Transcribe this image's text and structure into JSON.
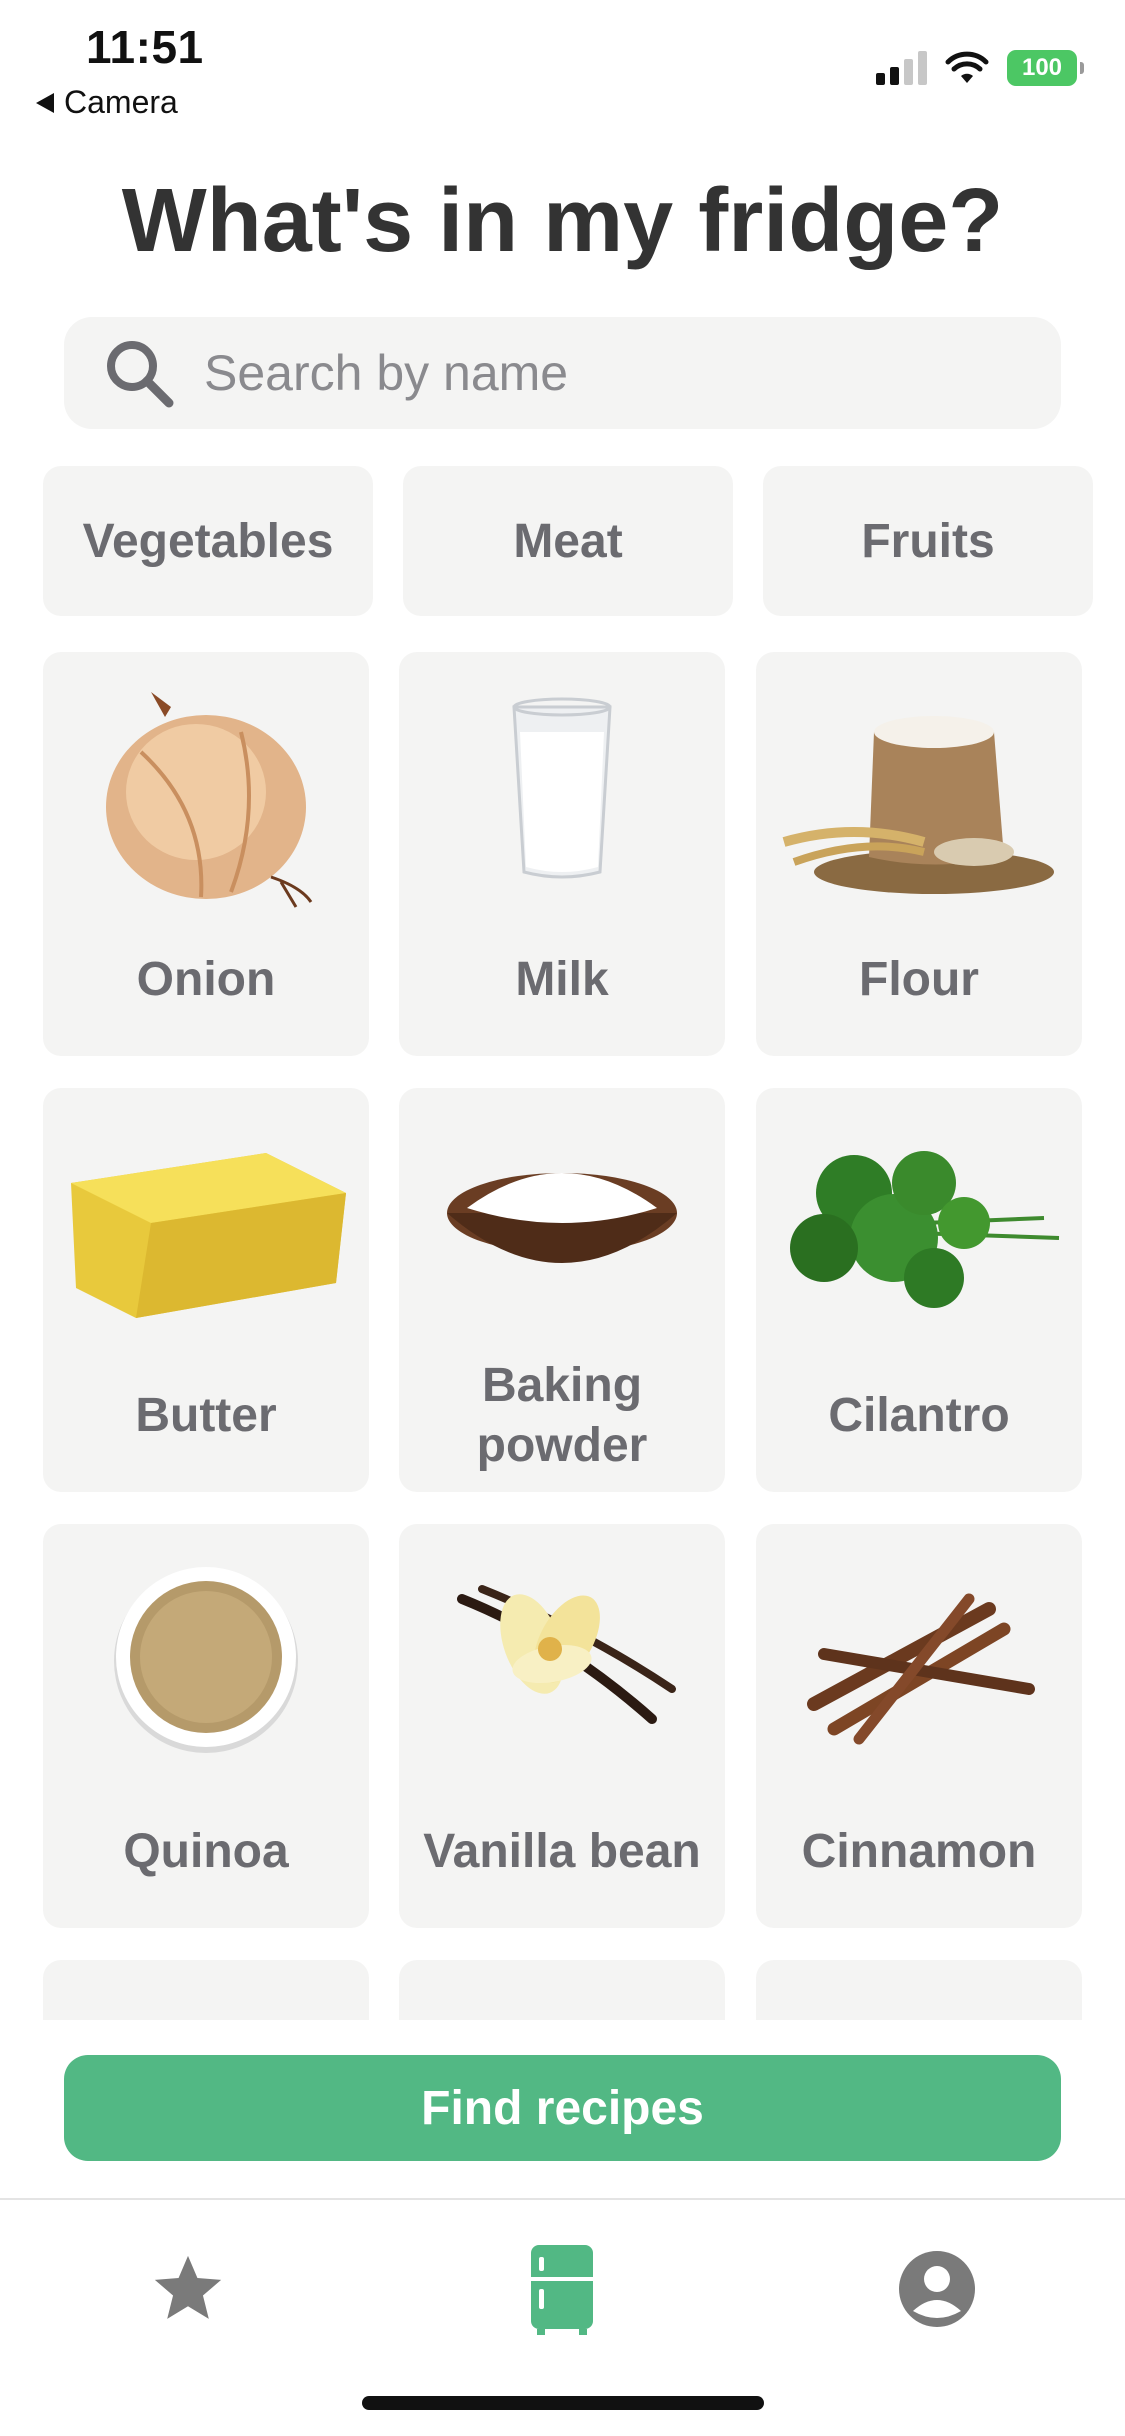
{
  "status_bar": {
    "time": "11:51",
    "back_label": "Camera",
    "battery": "100"
  },
  "page": {
    "title": "What's in my fridge?"
  },
  "search": {
    "placeholder": "Search by name",
    "value": ""
  },
  "categories": [
    "Vegetables",
    "Meat",
    "Fruits"
  ],
  "ingredients": [
    {
      "name": "Onion",
      "icon": "onion-image"
    },
    {
      "name": "Milk",
      "icon": "milk-image"
    },
    {
      "name": "Flour",
      "icon": "flour-image"
    },
    {
      "name": "Butter",
      "icon": "butter-image"
    },
    {
      "name": "Baking powder",
      "icon": "baking-powder-image"
    },
    {
      "name": "Cilantro",
      "icon": "cilantro-image"
    },
    {
      "name": "Quinoa",
      "icon": "quinoa-image"
    },
    {
      "name": "Vanilla bean",
      "icon": "vanilla-bean-image"
    },
    {
      "name": "Cinnamon",
      "icon": "cinnamon-image"
    }
  ],
  "actions": {
    "find_recipes": "Find recipes"
  },
  "tabs": [
    {
      "name": "favorites",
      "icon": "star-icon"
    },
    {
      "name": "fridge",
      "icon": "fridge-icon",
      "active": true
    },
    {
      "name": "profile",
      "icon": "profile-icon"
    }
  ],
  "colors": {
    "accent": "#52b884",
    "chip_bg": "#f4f4f3",
    "label": "#6b6b70",
    "tab_inactive": "#7a7a7a"
  }
}
